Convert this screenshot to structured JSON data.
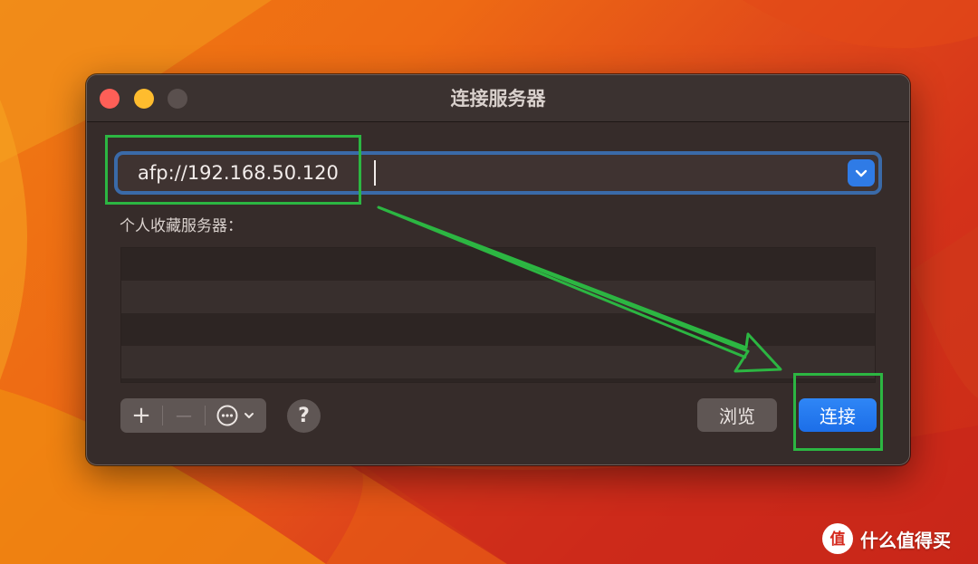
{
  "window": {
    "title": "连接服务器"
  },
  "address": {
    "value": "afp://192.168.50.120"
  },
  "favorites": {
    "label": "个人收藏服务器：",
    "rows": [
      "",
      "",
      "",
      ""
    ]
  },
  "toolbar": {
    "add_symbol": "+",
    "remove_symbol": "—",
    "help_symbol": "?",
    "browse_label": "浏览",
    "connect_label": "连接"
  },
  "watermark": {
    "text": "什么值得买"
  },
  "colors": {
    "accent": "#2f7be6",
    "annotation": "#2cb642",
    "dialog_bg": "#362c2a"
  }
}
